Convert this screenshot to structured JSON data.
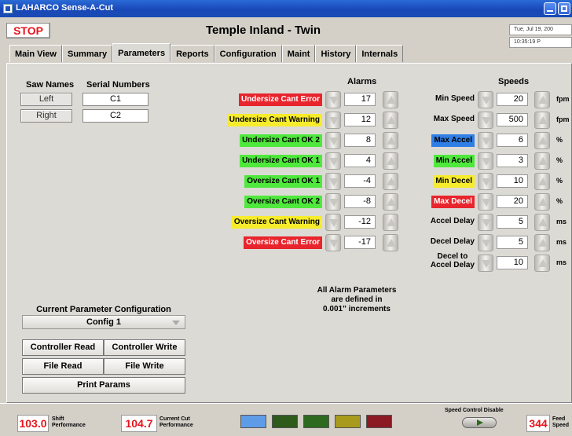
{
  "window": {
    "title": "LAHARCO Sense-A-Cut"
  },
  "header": {
    "stop_label": "STOP",
    "plant_title": "Temple Inland  -  Twin",
    "date": "Tue, Jul 19, 200",
    "time": "10:35:19 P"
  },
  "tabs": [
    "Main View",
    "Summary",
    "Parameters",
    "Reports",
    "Configuration",
    "Maint",
    "History",
    "Internals"
  ],
  "active_tab": "Parameters",
  "saws": {
    "names_header": "Saw Names",
    "serials_header": "Serial Numbers",
    "rows": [
      {
        "name": "Left",
        "serial": "C1"
      },
      {
        "name": "Right",
        "serial": "C2"
      }
    ]
  },
  "alarms": {
    "header": "Alarms",
    "rows": [
      {
        "label": "Undersize Cant Error",
        "value": "17",
        "color": "red"
      },
      {
        "label": "Undersize Cant Warning",
        "value": "12",
        "color": "yellow"
      },
      {
        "label": "Undersize Cant OK 2",
        "value": "8",
        "color": "green"
      },
      {
        "label": "Undersize Cant OK 1",
        "value": "4",
        "color": "green"
      },
      {
        "label": "Oversize Cant OK 1",
        "value": "-4",
        "color": "green"
      },
      {
        "label": "Oversize Cant OK 2",
        "value": "-8",
        "color": "green"
      },
      {
        "label": "Oversize Cant Warning",
        "value": "-12",
        "color": "yellow"
      },
      {
        "label": "Oversize Cant Error",
        "value": "-17",
        "color": "red"
      }
    ],
    "note_line1": "All Alarm Parameters",
    "note_line2": "are defined in",
    "note_line3": "0.001\" increments"
  },
  "speeds": {
    "header": "Speeds",
    "rows": [
      {
        "label": "Min Speed",
        "value": "20",
        "unit": "fpm",
        "color": "none"
      },
      {
        "label": "Max Speed",
        "value": "500",
        "unit": "fpm",
        "color": "none"
      },
      {
        "label": "Max Accel",
        "value": "6",
        "unit": "%",
        "color": "blue"
      },
      {
        "label": "Min Accel",
        "value": "3",
        "unit": "%",
        "color": "green"
      },
      {
        "label": "Min Decel",
        "value": "10",
        "unit": "%",
        "color": "yellow"
      },
      {
        "label": "Max Decel",
        "value": "20",
        "unit": "%",
        "color": "red"
      },
      {
        "label": "Accel Delay",
        "value": "5",
        "unit": "ms",
        "color": "none"
      },
      {
        "label": "Decel Delay",
        "value": "5",
        "unit": "ms",
        "color": "none"
      },
      {
        "label": "Decel to Accel Delay",
        "value": "10",
        "unit": "ms",
        "color": "none"
      }
    ],
    "decel_to_accel_line1": "Decel to",
    "decel_to_accel_line2": "Accel Delay"
  },
  "config": {
    "title": "Current Parameter Configuration",
    "selected": "Config 1",
    "buttons": {
      "controller_read": "Controller Read",
      "controller_write": "Controller Write",
      "file_read": "File Read",
      "file_write": "File Write",
      "print_params": "Print Params"
    }
  },
  "status": {
    "shift_value": "103.0",
    "shift_label_1": "Shift",
    "shift_label_2": "Performance",
    "cut_value": "104.7",
    "cut_label_1": "Current Cut",
    "cut_label_2": "Performance",
    "speed_control_label": "Speed Control Disable",
    "feed_value": "344",
    "feed_label_1": "Feed",
    "feed_label_2": "Speed",
    "lamp_colors": [
      "#5f9ce8",
      "#2e5a1c",
      "#2d6a1f",
      "#a89a1c",
      "#8a1a24"
    ]
  },
  "colors": {
    "red": "#e8242c",
    "yellow": "#f7ec2c",
    "green": "#4fe83c",
    "blue": "#2f7fe6",
    "stop": "#e8141c"
  }
}
